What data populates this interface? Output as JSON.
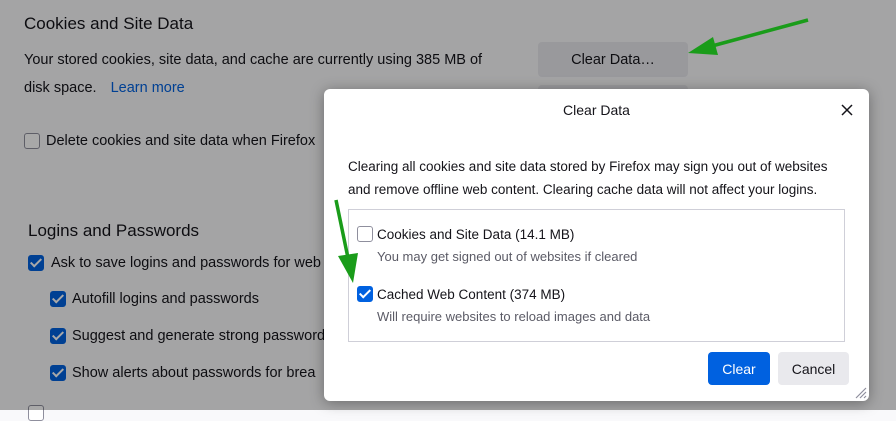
{
  "background": {
    "cookies_heading": "Cookies and Site Data",
    "usage_line1": "Your stored cookies, site data, and cache are currently using 385 MB of",
    "usage_line2": "disk space.",
    "learn_more": "Learn more",
    "clear_data_button": "Clear Data…",
    "delete_on_close": "Delete cookies and site data when Firefox",
    "logins_heading": "Logins and Passwords",
    "ask_to_save": "Ask to save logins and passwords for web",
    "autofill": "Autofill logins and passwords",
    "suggest": "Suggest and generate strong password",
    "show_alerts": "Show alerts about passwords for brea"
  },
  "dialog": {
    "title": "Clear Data",
    "description": "Clearing all cookies and site data stored by Firefox may sign you out of websites and remove offline web content. Clearing cache data will not affect your logins.",
    "options": [
      {
        "label": "Cookies and Site Data (14.1 MB)",
        "desc": "You may get signed out of websites if cleared",
        "checked": false
      },
      {
        "label": "Cached Web Content (374 MB)",
        "desc": "Will require websites to reload images and data",
        "checked": true
      }
    ],
    "clear_button": "Clear",
    "cancel_button": "Cancel"
  },
  "colors": {
    "accent": "#0061e0",
    "annotation_arrow": "#1a9c1a"
  }
}
